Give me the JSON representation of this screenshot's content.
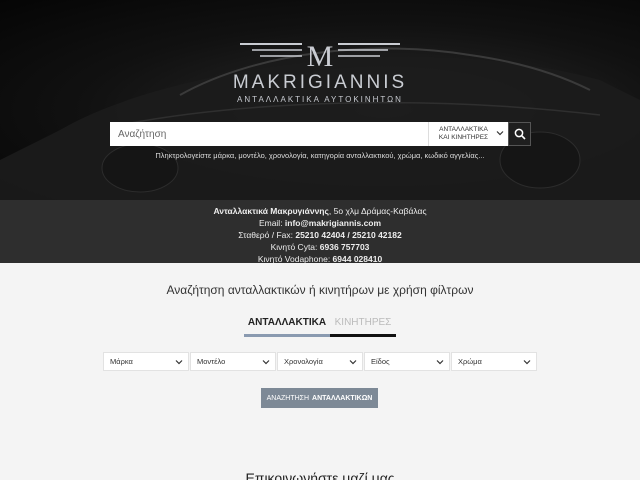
{
  "header": {
    "brand": "MAKRIGIANNIS",
    "tagline": "ΑΝΤΑΛΛΑΚΤΙΚΑ ΑΥΤΟΚΙΝΗΤΩΝ",
    "logo_letter": "M"
  },
  "search": {
    "placeholder": "Αναζήτηση",
    "category_line1": "ΑΝΤΑΛΛΑΚΤΙΚΑ",
    "category_line2": "ΚΑΙ ΚΙΝΗΤΗΡΕΣ",
    "hint": "Πληκτρολογείστε μάρκα, μοντέλο, χρονολογία, κατηγορία ανταλλακτικού, χρώμα, κωδικό αγγελίας..."
  },
  "contact": {
    "company": "Ανταλλακτικά Μακρυγιάννης",
    "address": ", 5ο χλμ Δράμας-Καβάλας",
    "email_label": "Email: ",
    "email": "info@makrigiannis.com",
    "phone_label": "Σταθερό / Fax: ",
    "phone1": "25210 42404",
    "phone_sep": " / ",
    "phone2": "25210 42182",
    "cyta_label": "Κινητό Cyta: ",
    "cyta": "6936 757703",
    "vodafone_label": "Κινητό Vodaphone: ",
    "vodafone": "6944 028410"
  },
  "main": {
    "heading": "Αναζήτηση ανταλλακτικών ή κινητήρων με χρήση φίλτρων",
    "tabs": [
      {
        "label": "ΑΝΤΑΛΛΑΚΤΙΚΑ"
      },
      {
        "label": "ΚΙΝΗΤΗΡΕΣ"
      }
    ],
    "filters": [
      {
        "label": "Μάρκα"
      },
      {
        "label": "Μοντέλο"
      },
      {
        "label": "Χρονολογία"
      },
      {
        "label": "Είδος"
      },
      {
        "label": "Χρώμα"
      }
    ],
    "submit_prefix": "ΑΝΑΖΗΤΗΣΗ",
    "submit_bold": "ΑΝΤΑΛΛΑΚΤΙΚΩΝ",
    "contact_heading": "Επικοινωνήστε μαζί μας"
  },
  "icons": {
    "search": "search-icon",
    "chevron": "chevron-down-icon",
    "logo": "logo-m-icon"
  },
  "colors": {
    "hero_bg": "#111111",
    "contact_bg": "#2e2e2e",
    "accent": "#8a9ab0",
    "button": "#7d8996"
  }
}
